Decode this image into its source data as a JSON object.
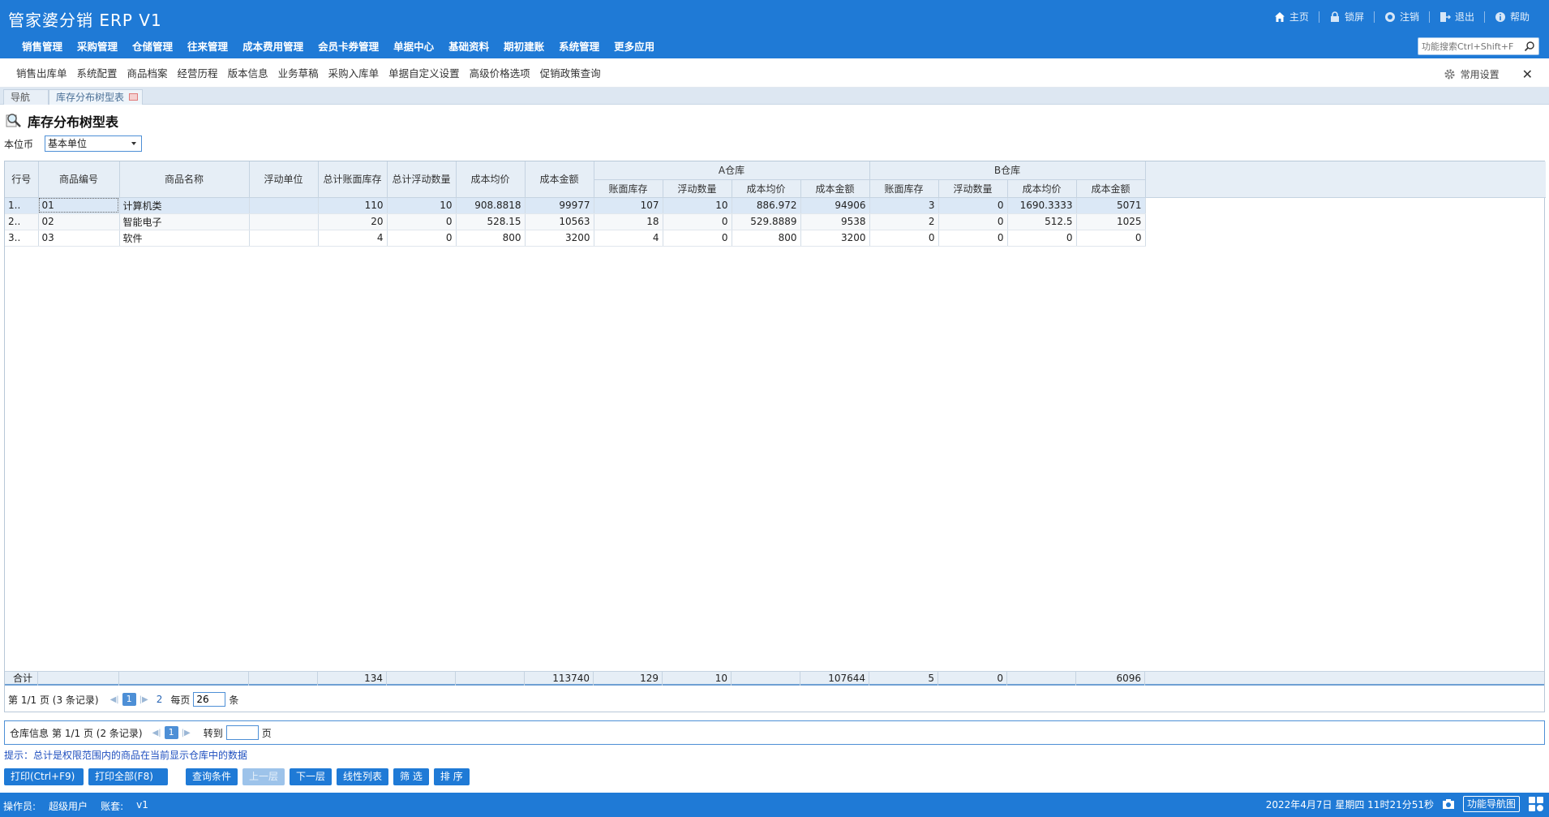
{
  "app": {
    "title": "管家婆分销 ERP V1"
  },
  "top_actions": [
    {
      "label": "主页",
      "icon": "home-icon"
    },
    {
      "label": "锁屏",
      "icon": "lock-icon"
    },
    {
      "label": "注销",
      "icon": "logout-circle-icon"
    },
    {
      "label": "退出",
      "icon": "exit-icon"
    },
    {
      "label": "帮助",
      "icon": "help-icon"
    }
  ],
  "main_menu": [
    "销售管理",
    "采购管理",
    "仓储管理",
    "往来管理",
    "成本费用管理",
    "会员卡券管理",
    "单据中心",
    "基础资料",
    "期初建账",
    "系统管理",
    "更多应用"
  ],
  "search": {
    "placeholder": "功能搜索Ctrl+Shift+F"
  },
  "quick_links": [
    "销售出库单",
    "系统配置",
    "商品档案",
    "经营历程",
    "版本信息",
    "业务草稿",
    "采购入库单",
    "单据自定义设置",
    "高级价格选项",
    "促销政策查询"
  ],
  "quick_settings_label": "常用设置",
  "tabs": {
    "nav": "导航",
    "active": "库存分布树型表"
  },
  "page": {
    "title": "库存分布树型表",
    "currency_label": "本位币",
    "unit_select": "基本单位"
  },
  "grid": {
    "headers": {
      "row_no": "行号",
      "code": "商品编号",
      "name": "商品名称",
      "float_unit": "浮动单位",
      "total_book_stock": "总计账面库存",
      "total_float_qty": "总计浮动数量",
      "avg_cost": "成本均价",
      "cost_amount": "成本金额",
      "warehouse_a": "A仓库",
      "warehouse_b": "B仓库",
      "sub_book_stock": "账面库存",
      "sub_float_qty": "浮动数量",
      "sub_avg_cost": "成本均价",
      "sub_cost_amount": "成本金额"
    },
    "rows": [
      {
        "no": "1..",
        "code": "01",
        "name": "计算机类",
        "unit": "",
        "total_stock": "110",
        "total_float": "10",
        "avg_cost": "908.8818",
        "cost_amount": "99977",
        "a_stock": "107",
        "a_float": "10",
        "a_avg": "886.972",
        "a_amount": "94906",
        "b_stock": "3",
        "b_float": "0",
        "b_avg": "1690.3333",
        "b_amount": "5071"
      },
      {
        "no": "2..",
        "code": "02",
        "name": "智能电子",
        "unit": "",
        "total_stock": "20",
        "total_float": "0",
        "avg_cost": "528.15",
        "cost_amount": "10563",
        "a_stock": "18",
        "a_float": "0",
        "a_avg": "529.8889",
        "a_amount": "9538",
        "b_stock": "2",
        "b_float": "0",
        "b_avg": "512.5",
        "b_amount": "1025"
      },
      {
        "no": "3..",
        "code": "03",
        "name": "软件",
        "unit": "",
        "total_stock": "4",
        "total_float": "0",
        "avg_cost": "800",
        "cost_amount": "3200",
        "a_stock": "4",
        "a_float": "0",
        "a_avg": "800",
        "a_amount": "3200",
        "b_stock": "0",
        "b_float": "0",
        "b_avg": "0",
        "b_amount": "0"
      }
    ],
    "totals": {
      "label": "合计",
      "total_stock": "134",
      "cost_amount": "113740",
      "a_stock": "129",
      "a_float": "10",
      "a_amount": "107644",
      "b_stock": "5",
      "b_float": "0",
      "b_amount": "6096"
    }
  },
  "pager": {
    "page_info": "第  1/1 页  (3 条记录)",
    "current_page": "1",
    "next_page": "2",
    "per_page_label": "每页",
    "per_page_value": "26",
    "per_page_suffix": "条"
  },
  "warehouse_pager": {
    "label": "仓库信息",
    "page_info": "第  1/1 页  (2 条记录)",
    "current_page": "1",
    "goto_label": "转到",
    "goto_suffix": "页"
  },
  "hint": "提示：总计是权限范围内的商品在当前显示仓库中的数据",
  "actions": {
    "print": "打印(Ctrl+F9)",
    "print_all": "打印全部(F8)",
    "query": "查询条件",
    "up_level": "上一层",
    "down_level": "下一层",
    "linear_list": "线性列表",
    "filter": "筛 选",
    "sort": "排 序"
  },
  "status": {
    "operator_label": "操作员:",
    "operator": "超级用户",
    "account_label": "账套:",
    "account": "v1",
    "datetime": "2022年4月7日  星期四  11时21分51秒",
    "nav_map": "功能导航图"
  }
}
